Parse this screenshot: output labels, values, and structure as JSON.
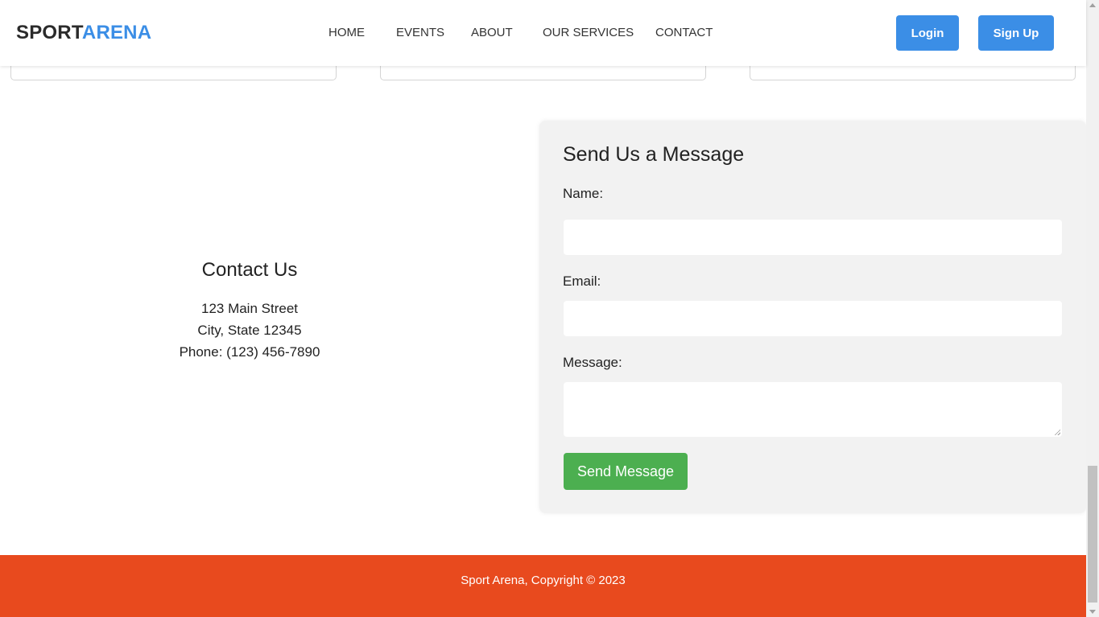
{
  "header": {
    "logo_part1": "SPORT",
    "logo_part2": "ARENA",
    "nav": [
      "HOME",
      "EVENTS",
      "ABOUT",
      "OUR SERVICES",
      "CONTACT"
    ],
    "login_label": "Login",
    "signup_label": "Sign Up"
  },
  "contact": {
    "title": "Contact Us",
    "street": "123 Main Street",
    "city": "City, State 12345",
    "phone": "Phone: (123) 456-7890"
  },
  "form": {
    "title": "Send Us a Message",
    "name_label": "Name:",
    "email_label": "Email:",
    "message_label": "Message:",
    "name_value": "",
    "email_value": "",
    "message_value": "",
    "submit_label": "Send Message"
  },
  "footer": {
    "copyright": "Sport Arena, Copyright © 2023"
  },
  "colors": {
    "brand_blue": "#3b8ee6",
    "submit_green": "#4caf50",
    "footer_orange": "#e84a1e",
    "panel_gray": "#f2f2f2"
  }
}
